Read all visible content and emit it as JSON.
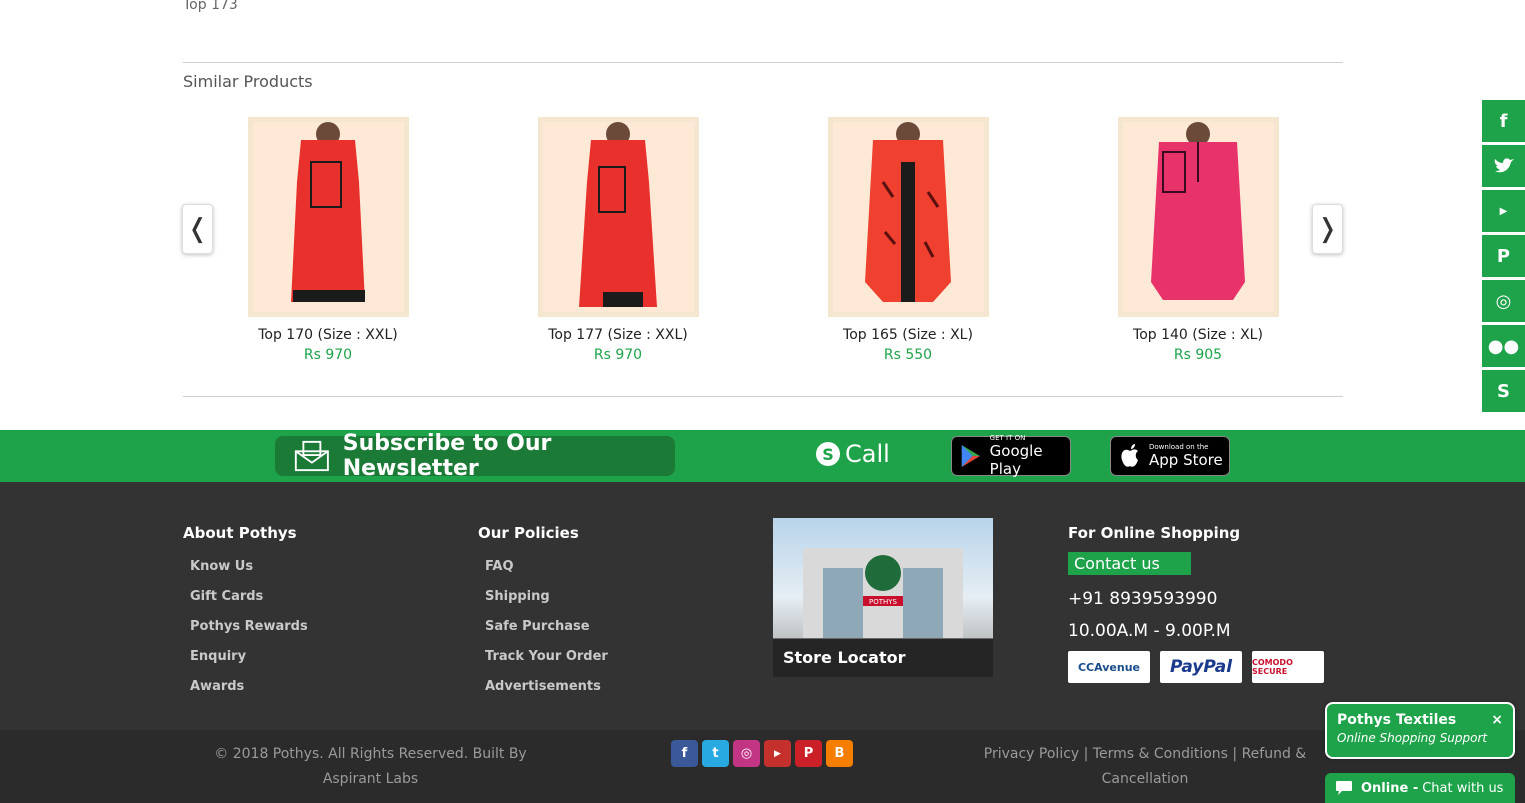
{
  "breadcrumb": "Top 173",
  "similar": {
    "title": "Similar Products",
    "prev_icon": "chevron-left-icon",
    "next_icon": "chevron-right-icon",
    "prev_glyph": "❬",
    "next_glyph": "❭",
    "products": [
      {
        "name": "Top 170 (Size : XXL)",
        "price": "Rs 970",
        "color": "#e8312c"
      },
      {
        "name": "Top 177 (Size : XXL)",
        "price": "Rs 970",
        "color": "#e8312c"
      },
      {
        "name": "Top 165 (Size : XL)",
        "price": "Rs 550",
        "color": "#f0402f"
      },
      {
        "name": "Top 140 (Size : XL)",
        "price": "Rs 905",
        "color": "#e8336a"
      }
    ]
  },
  "band": {
    "newsletter": "Subscribe to Our Newsletter",
    "call": "Call",
    "google_small": "GET IT ON",
    "google_big": "Google Play",
    "apple_small": "Download on the",
    "apple_big": "App Store"
  },
  "footer": {
    "about": {
      "heading": "About Pothys",
      "items": [
        "Know Us",
        "Gift Cards",
        "Pothys Rewards",
        "Enquiry",
        "Awards"
      ]
    },
    "policies": {
      "heading": "Our Policies",
      "items": [
        "FAQ",
        "Shipping",
        "Safe Purchase",
        "Track Your Order",
        "Advertisements"
      ]
    },
    "store_locator": "Store Locator",
    "store_sign": "POTHYS",
    "online": {
      "heading": "For Online Shopping",
      "contact": "Contact us",
      "phone": "+91 8939593990",
      "hours": "10.00A.M - 9.00P.M"
    },
    "payments": [
      "CCAvenue",
      "PayPal",
      "COMODO SECURE"
    ]
  },
  "bottom": {
    "copyright": "© 2018 Pothys. All Rights Reserved. Built By Aspirant Labs",
    "links": "Privacy Policy | Terms & Conditions | Refund & Cancellation"
  },
  "colors": {
    "brand_green": "#1ea34a",
    "footer_bg": "#333333",
    "price_green": "#1ea34a"
  },
  "chat": {
    "title": "Pothys Textiles",
    "subtitle": "Online Shopping Support",
    "close": "×",
    "status": "Online -",
    "action": "Chat with us"
  }
}
